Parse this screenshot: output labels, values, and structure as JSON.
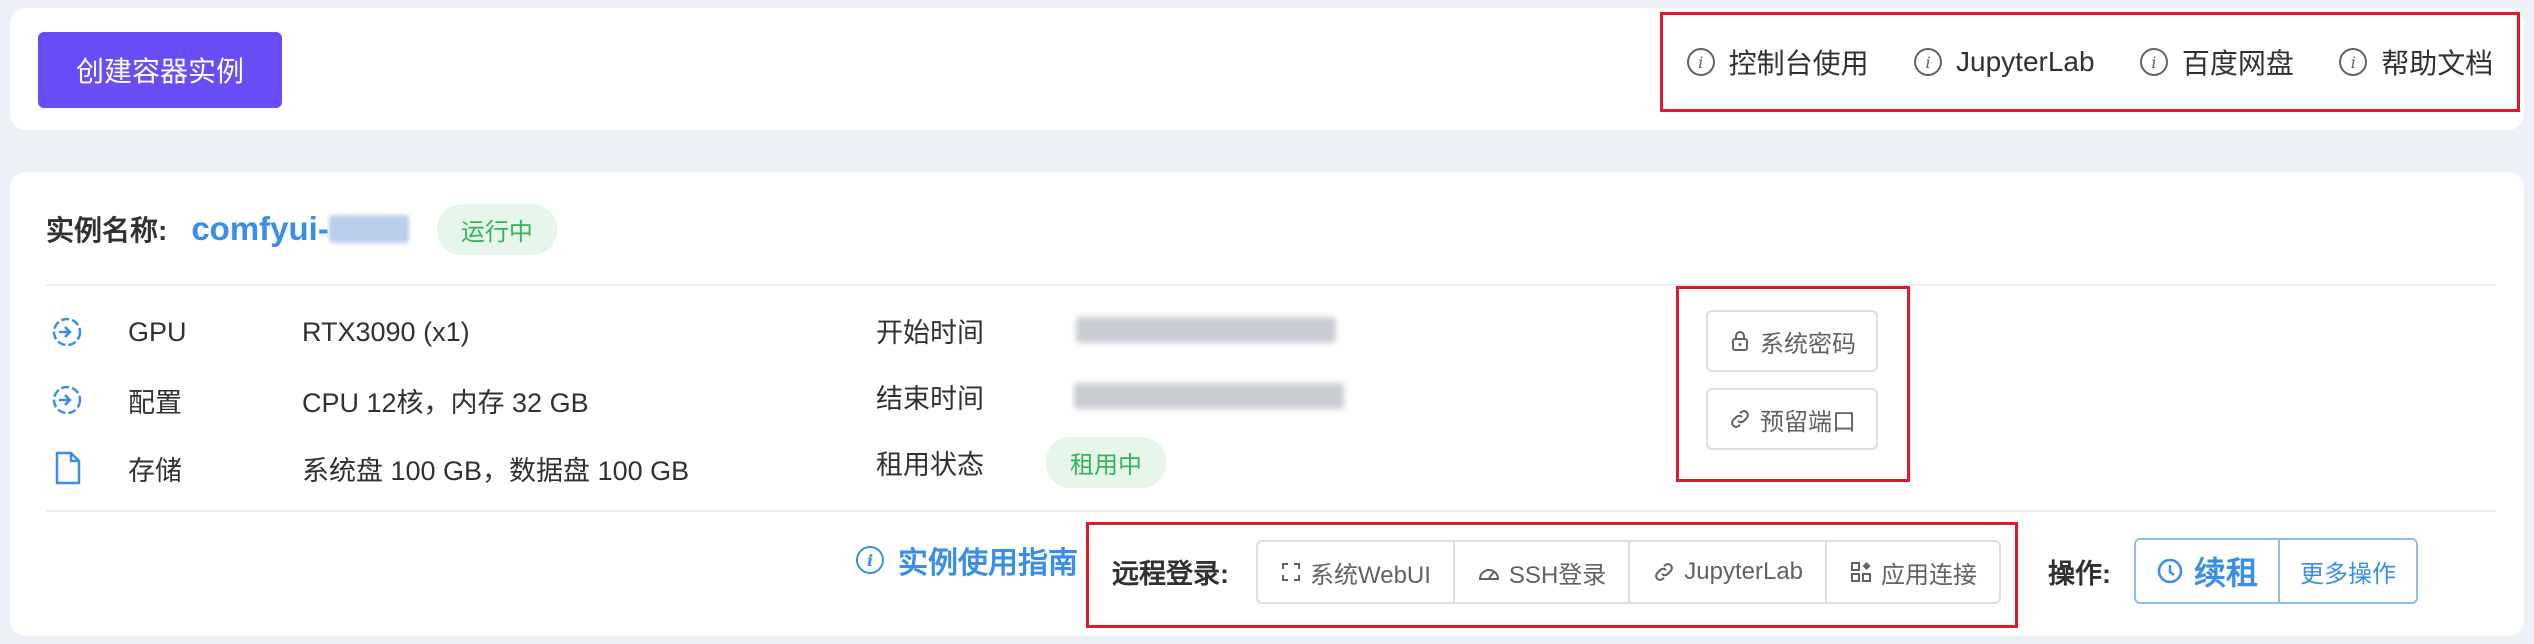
{
  "toolbar": {
    "create_label": "创建容器实例",
    "help_links": [
      {
        "label": "控制台使用",
        "icon": "info-icon"
      },
      {
        "label": "JupyterLab",
        "icon": "info-icon"
      },
      {
        "label": "百度网盘",
        "icon": "info-icon"
      },
      {
        "label": "帮助文档",
        "icon": "info-icon"
      }
    ]
  },
  "instance": {
    "name_label": "实例名称:",
    "name_value": "comfyui-",
    "status": "运行中",
    "specs": [
      {
        "label": "GPU",
        "value": "RTX3090 (x1)",
        "icon": "gpu-icon"
      },
      {
        "label": "配置",
        "value": "CPU 12核，内存 32 GB",
        "icon": "cpu-icon"
      },
      {
        "label": "存储",
        "value": "系统盘 100 GB，数据盘 100 GB",
        "icon": "file-icon"
      }
    ],
    "times": [
      {
        "label": "开始时间"
      },
      {
        "label": "结束时间"
      },
      {
        "label": "租用状态",
        "value": "租用中"
      }
    ],
    "system_password": "系统密码",
    "reserved_port": "预留端口",
    "guide_label": "实例使用指南",
    "remote_label": "远程登录:",
    "remote_buttons": [
      "系统WebUI",
      "SSH登录",
      "JupyterLab",
      "应用连接"
    ],
    "ops_label": "操作:",
    "renew_label": "续租",
    "more_label": "更多操作"
  },
  "colors": {
    "primary_purple": "#6a4cf5",
    "link_blue": "#3a8ee6",
    "success_green": "#36b35a",
    "highlight_red": "#e0192a"
  }
}
